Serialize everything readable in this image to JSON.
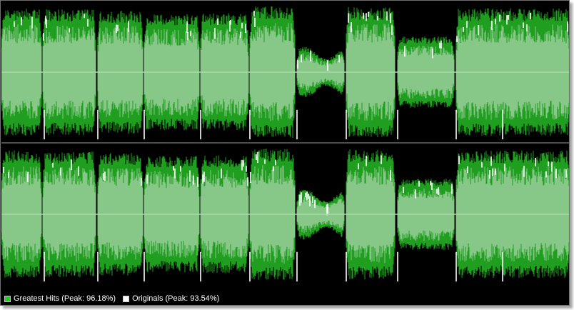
{
  "colors": {
    "background": "#000000",
    "greatest_hits_wave": "#1f9e1f",
    "greatest_hits_bright": "#34c534",
    "overlap_fill": "#87c787",
    "originals_wave": "#ffffff",
    "center_line": "#a8d8a8",
    "divider": "#9a9a9a"
  },
  "legend": {
    "greatest_hits": {
      "label": "Greatest Hits (Peak: 96.18%)",
      "swatch_color": "#22cc22"
    },
    "originals": {
      "label": "Originals (Peak: 93.54%)",
      "swatch_color": "#ffffff"
    }
  },
  "waveform": {
    "channels": [
      "left",
      "right"
    ],
    "greatest_hits_peak_percent": 96.18,
    "originals_peak_percent": 93.54
  }
}
